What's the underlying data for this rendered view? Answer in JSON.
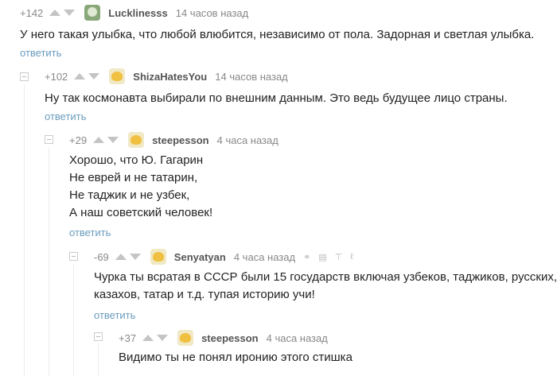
{
  "comments": [
    {
      "rating": "+142",
      "author": "Lucklinesss",
      "time": "14 часов назад",
      "text": [
        "У него такая улыбка, что любой влюбится, независимо от пола. Задорная и светлая улыбка."
      ],
      "reply": "ответить",
      "avatar": "green-avatar"
    },
    {
      "rating": "+102",
      "author": "ShizaHatesYou",
      "time": "14 часов назад",
      "text": [
        "Ну так космонавта выбирали по внешним данным. Это ведь будущее лицо страны."
      ],
      "reply": "ответить",
      "avatar": "default-face-avatar"
    },
    {
      "rating": "+29",
      "author": "steepesson",
      "time": "4 часа назад",
      "text": [
        "Хорошо, что Ю. Гагарин",
        "Не еврей и не татарин,",
        "Не таджик и не узбек,",
        "А наш советский человек!"
      ],
      "reply": "ответить",
      "avatar": "default-face-avatar"
    },
    {
      "rating": "-69",
      "author": "Senyatyan",
      "time": "4 часа назад",
      "text": [
        "Чурка ты всратая в СССР были 15 государств включая узбеков, таджиков, русских,",
        "казахов, татар и т.д. тупая историю учи!"
      ],
      "reply": "ответить",
      "avatar": "default-face-avatar",
      "tools": [
        "link-icon",
        "save-icon",
        "pin-top-icon",
        "font-icon"
      ]
    },
    {
      "rating": "+37",
      "author": "steepesson",
      "time": "4 часа назад",
      "text": [
        "Видимо ты не понял иронию этого стишка"
      ],
      "reply": "",
      "avatar": "default-face-avatar"
    }
  ]
}
